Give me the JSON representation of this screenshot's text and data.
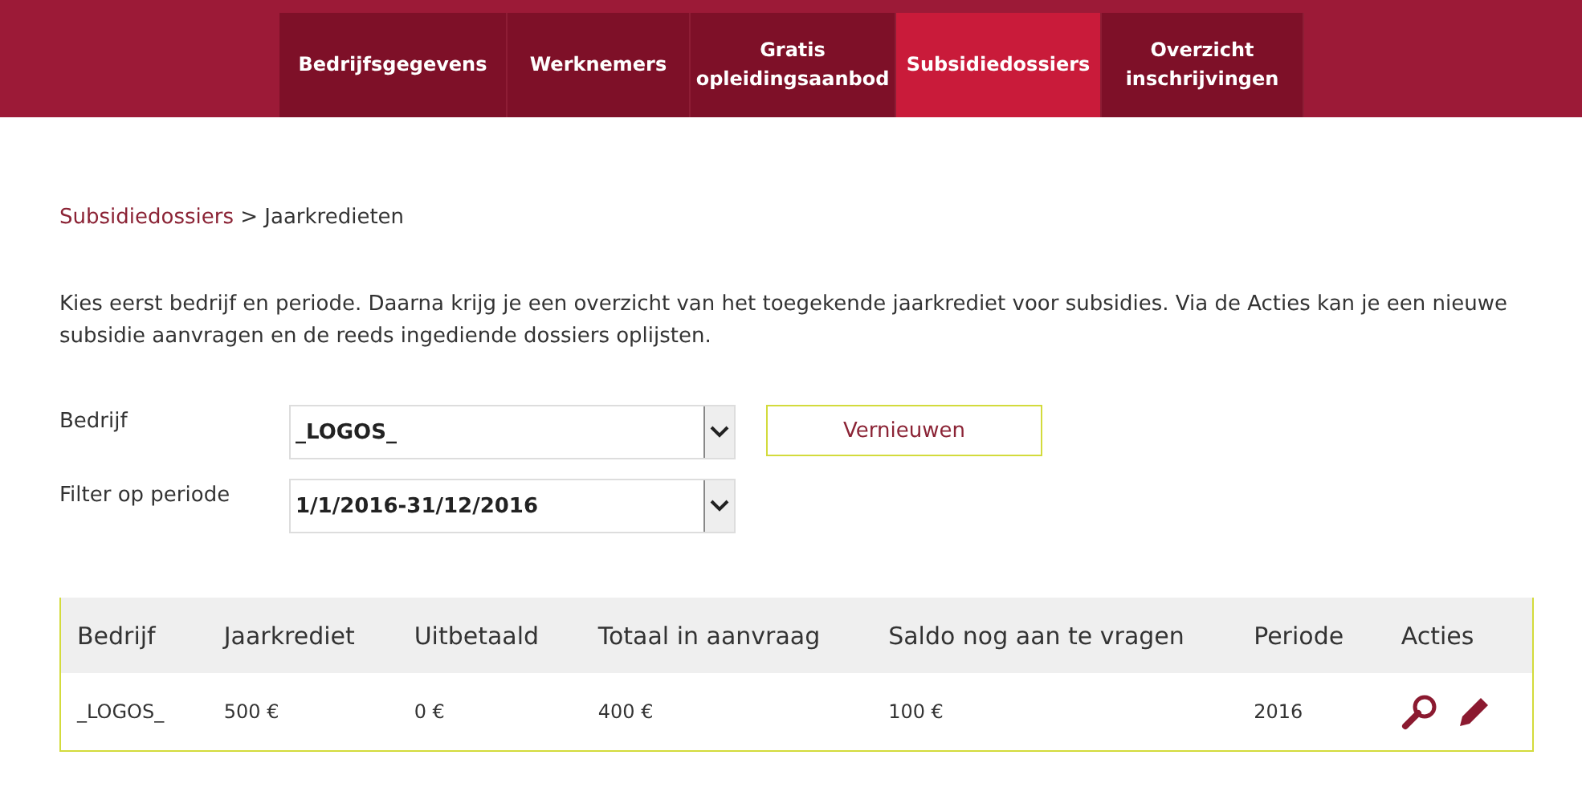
{
  "nav": [
    {
      "label": "Bedrijfsgegevens",
      "selected": false
    },
    {
      "label": "Werknemers",
      "selected": false
    },
    {
      "label": "Gratis opleidingsaanbod",
      "selected": false
    },
    {
      "label": "Subsidiedossiers",
      "selected": true
    },
    {
      "label": "Overzicht inschrijvingen",
      "selected": false
    }
  ],
  "breadcrumb": {
    "link": "Subsidiedossiers",
    "separator": ">",
    "current": "Jaarkredieten"
  },
  "intro": "Kies eerst bedrijf en periode. Daarna krijg je een overzicht van het toegekende jaarkrediet voor subsidies. Via de Acties kan je een nieuwe subsidie aanvragen en de reeds ingediende dossiers oplijsten.",
  "form": {
    "company": {
      "label": "Bedrijf",
      "value": "_LOGOS_"
    },
    "period": {
      "label": "Filter op periode",
      "value": "1/1/2016-31/12/2016"
    },
    "refresh_button": "Vernieuwen"
  },
  "table": {
    "columns": [
      "Bedrijf",
      "Jaarkrediet",
      "Uitbetaald",
      "Totaal in aanvraag",
      "Saldo nog aan te vragen",
      "Periode",
      "Acties"
    ],
    "rows": [
      {
        "cells": [
          "_LOGOS_",
          "500 €",
          "0 €",
          "400 €",
          "100 €",
          "2016"
        ],
        "actions": [
          {
            "kind": "view"
          },
          {
            "kind": "edit"
          }
        ]
      }
    ]
  }
}
